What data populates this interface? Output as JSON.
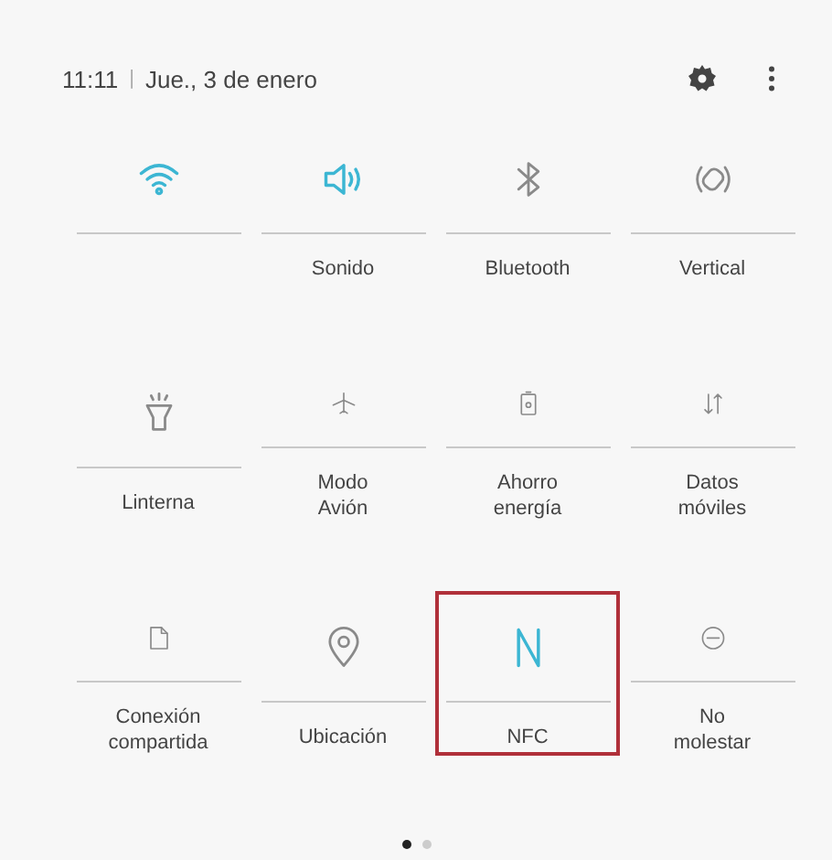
{
  "header": {
    "time": "11:11",
    "separator": "|",
    "date": "Jue., 3 de enero"
  },
  "tiles": [
    {
      "kind": "wifi",
      "on": true,
      "highlighted": false
    },
    {
      "kind": "sound",
      "label": "Sonido",
      "on": true,
      "highlighted": false
    },
    {
      "kind": "bluetooth",
      "label": "Bluetooth",
      "on": false,
      "highlighted": false
    },
    {
      "kind": "rotate",
      "label": "Vertical",
      "on": false,
      "highlighted": false
    },
    {
      "kind": "flashlight",
      "label": "Linterna",
      "on": false,
      "highlighted": false
    },
    {
      "kind": "airplane",
      "label": "Modo\nAvión",
      "on": false,
      "highlighted": false
    },
    {
      "kind": "battery",
      "label": "Ahorro\nenergía",
      "on": false,
      "highlighted": false
    },
    {
      "kind": "data",
      "label": "Datos\nmóviles",
      "on": false,
      "highlighted": false
    },
    {
      "kind": "hotspot",
      "label": "Conexión\ncompartida",
      "on": false,
      "highlighted": false
    },
    {
      "kind": "location",
      "label": "Ubicación",
      "on": false,
      "highlighted": false
    },
    {
      "kind": "nfc",
      "label": "NFC",
      "on": true,
      "highlighted": true
    },
    {
      "kind": "dnd",
      "label": "No\nmolestar",
      "on": false,
      "highlighted": false
    }
  ],
  "pages": [
    {
      "selected": true
    },
    {
      "selected": false
    }
  ]
}
